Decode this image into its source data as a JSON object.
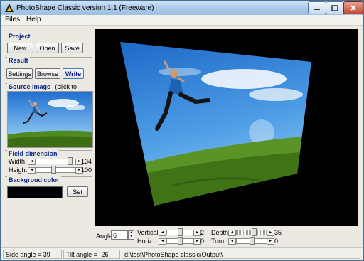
{
  "window": {
    "title": "PhotoShape Classic version 1.1 (Freeware)"
  },
  "menu": {
    "files": "Files",
    "help": "Help"
  },
  "project": {
    "title": "Project",
    "new": "New",
    "open": "Open",
    "save": "Save"
  },
  "result": {
    "title": "Result",
    "settings": "Settings",
    "browse": "Browse",
    "write": "Write"
  },
  "source": {
    "title": "Source image",
    "hint": "(click to load)"
  },
  "field": {
    "title": "Field dimension",
    "width_label": "Width",
    "width_value": "134",
    "height_label": "Height",
    "height_value": "100"
  },
  "bg": {
    "title": "Backgroud color",
    "set": "Set",
    "color": "#000000"
  },
  "controls": {
    "angle_label": "Angle",
    "angle_value": "6",
    "vertical_label": "Vertical",
    "vertical_value": "2",
    "horiz_label": "Horiz.",
    "horiz_value": "0",
    "depth_label": "Depth",
    "depth_value": "35",
    "turn_label": "Turn",
    "turn_value": "0"
  },
  "status": {
    "side_angle": "Side angle = 39",
    "tilt_angle": "Tilt angle = -26",
    "path": "d:\\test\\PhotoShape classic\\Output\\"
  },
  "colors": {
    "accent": "#0b2a8c",
    "sky": "#3b8fe0",
    "grass": "#4f8a1e"
  },
  "icons": [
    "app-icon",
    "minimize-icon",
    "maximize-icon",
    "close-icon",
    "spin-up-icon",
    "spin-down-icon"
  ]
}
